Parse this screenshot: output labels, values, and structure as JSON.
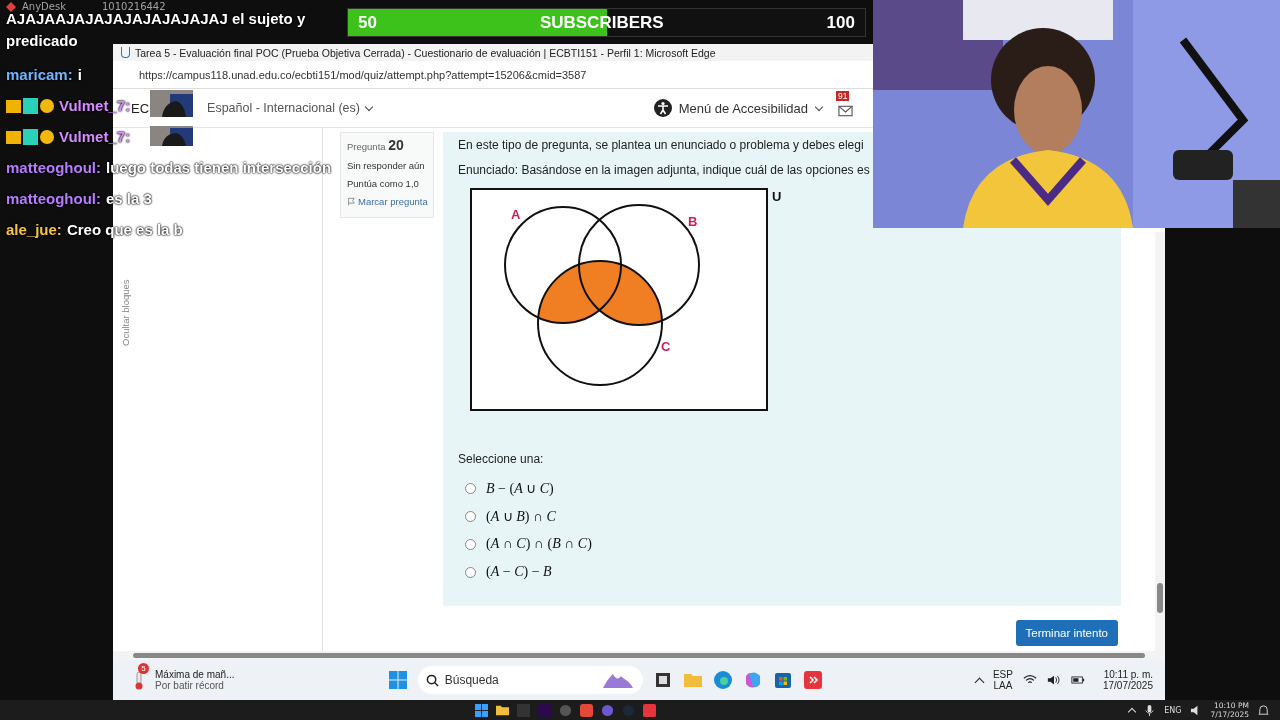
{
  "subscriber_goal": {
    "current": "50",
    "label": "SUBSCRIBERS",
    "target": "100",
    "level": 0.5
  },
  "remote_app": {
    "name": "AnyDesk",
    "id": "1010216442"
  },
  "chat": [
    {
      "text": "AJAJAAJAJAJAJAJAJAJAJAJ el sujeto y predicado"
    },
    {
      "user": "maricam:",
      "color": "#6fb6ff",
      "text": "i"
    },
    {
      "user": "Vulmet_7:",
      "color": "#d68cff",
      "badges": true
    },
    {
      "user": "Vulmet_7:",
      "color": "#d68cff",
      "badges": true
    },
    {
      "user": "matteoghoul:",
      "color": "#b77cff",
      "text": "luego todas tienen intersección"
    },
    {
      "user": "matteoghoul:",
      "color": "#b77cff",
      "text": "es la 3"
    },
    {
      "user": "ale_jue:",
      "color": "#f5c542",
      "text": "Creo que es la b"
    }
  ],
  "browser": {
    "title": "Tarea 5 - Evaluación final POC (Prueba Objetiva Cerrada) - Cuestionario de evaluación | ECBTI151 - Perfil 1: Microsoft Edge",
    "url": "https://campus118.unad.edu.co/ecbti151/mod/quiz/attempt.php?attempt=15206&cmid=3587"
  },
  "header": {
    "course": "EC",
    "language": "Español - Internacional (es)",
    "accessibility": "Menú de Accesibilidad",
    "notifications": "91"
  },
  "blocks_toggle": "Ocultar bloques",
  "question_info": {
    "label": "Pregunta",
    "number": "20",
    "status": "Sin responder aún",
    "points": "Puntúa como 1,0",
    "flag": "Marcar pregunta"
  },
  "question": {
    "intro": "En este tipo de pregunta, se plantea un enunciado o problema y debes elegi",
    "statement": "Enunciado: Basándose en la imagen adjunta, indique cuál de las opciones es",
    "venn_labels": [
      "A",
      "B",
      "C",
      "U"
    ],
    "prompt": "Seleccione una:",
    "options": [
      {
        "text": "*B* − (*A* ∪ *C*)",
        "selected": false
      },
      {
        "text": "(*A* ∪ *B*) ∩ *C*",
        "selected": false
      },
      {
        "text": "(*A* ∩ *C*) ∩ (*B* ∩ *C*)",
        "selected": false
      },
      {
        "text": "(*A* − *C*) − *B*",
        "selected": false
      }
    ]
  },
  "finish_button": "Terminar intento",
  "taskbar": {
    "weather_badge": "5",
    "weather_title": "Máxima de mañ...",
    "weather_sub": "Por batir récord",
    "search": "Búsqueda",
    "lang": "ESP",
    "layout": "LAA",
    "time": "10:11 p. m.",
    "date": "17/07/2025"
  },
  "host_taskbar": {
    "lang": "ENG",
    "time": "10:10 PM",
    "date": "7/17/2025"
  }
}
